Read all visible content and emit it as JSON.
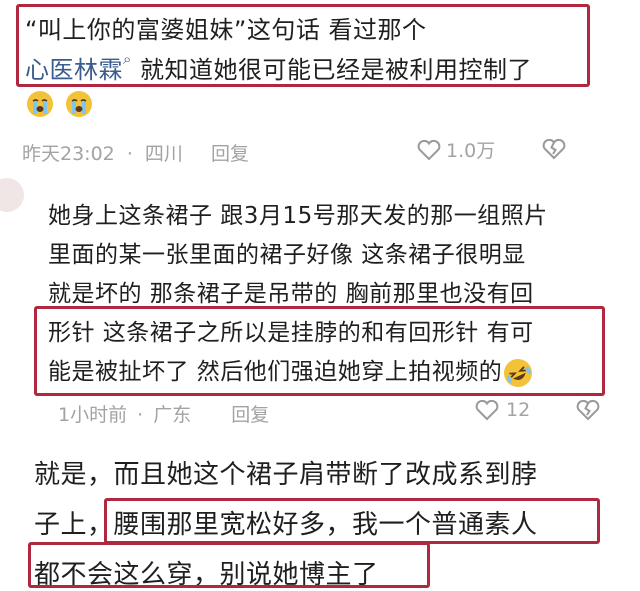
{
  "comment1": {
    "line1": "“叫上你的富婆姐妹”这句话 看过那个",
    "topic_link": "心医林霖",
    "line2_rest": "就知道她很可能已经是被利用控制了",
    "emoji_icons": [
      "crying-face-icon",
      "crying-face-icon"
    ],
    "time": "昨天23:02",
    "location": "四川",
    "reply_label": "回复",
    "like_count": "1.0万"
  },
  "comment2": {
    "lines": [
      "她身上这条裙子 跟3月15号那天发的那一组照片",
      "里面的某一张里面的裙子好像 这条裙子很明显",
      "就是坏的 那条裙子是吊带的 胸前那里也没有回",
      "形针 这条裙子之所以是挂脖的和有回形针 有可",
      "能是被扯坏了 然后他们强迫她穿上拍视频的"
    ],
    "emoji_icon": "rolling-laughing-icon",
    "time": "1小时前",
    "location": "广东",
    "reply_label": "回复",
    "like_count": "12"
  },
  "comment3": {
    "lines": [
      "就是，而且她这个裙子肩带断了改成系到脖",
      "子上，腰围那里宽松好多，我一个普通素人",
      "都不会这么穿，别说她博主了"
    ]
  },
  "colors": {
    "highlight_border": "#b0283f",
    "topic_link": "#3a5b8e",
    "meta_text": "#a3a3a3",
    "body_text": "#1f1f1f"
  }
}
